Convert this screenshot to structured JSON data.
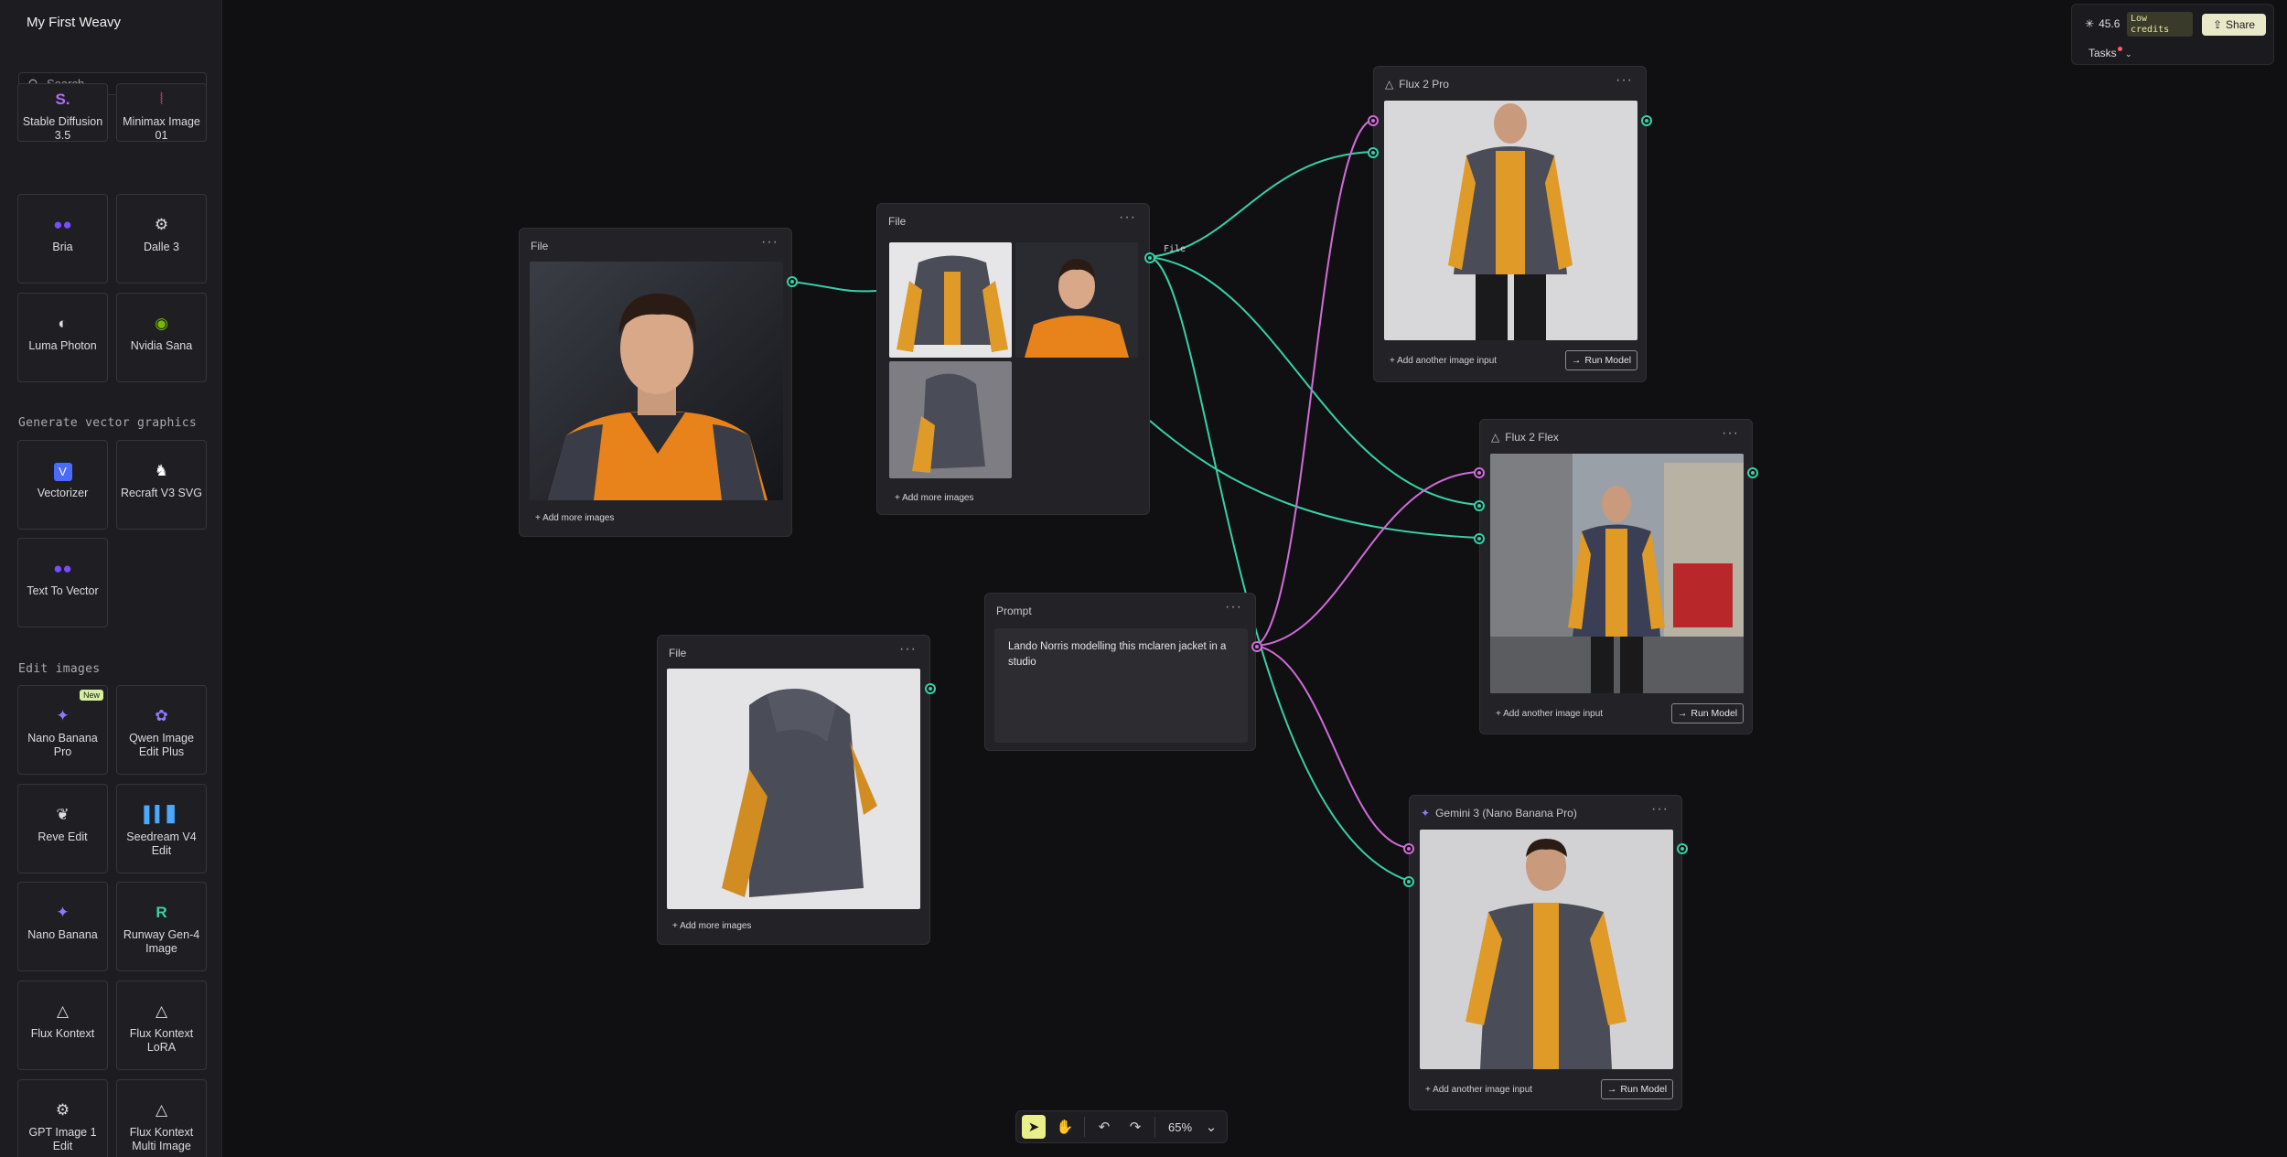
{
  "sidebar": {
    "title": "My First Weavy",
    "search_placeholder": "Search",
    "top_tiles": [
      {
        "label": "Stable Diffusion 3.5",
        "icon": "stable-diffusion-icon",
        "color": "#b36bff"
      },
      {
        "label": "Minimax Image 01",
        "icon": "minimax-icon",
        "color": "#e0506a"
      },
      {
        "label": "Bria",
        "icon": "bria-icon",
        "color": "#7a4cff"
      },
      {
        "label": "Dalle 3",
        "icon": "openai-icon",
        "color": "#dddddd"
      },
      {
        "label": "Luma Photon",
        "icon": "luma-icon",
        "color": "#dddddd"
      },
      {
        "label": "Nvidia Sana",
        "icon": "nvidia-icon",
        "color": "#76b900"
      }
    ],
    "vector_section": {
      "label": "Generate vector graphics",
      "tiles": [
        {
          "label": "Vectorizer",
          "icon": "vectorizer-icon",
          "color": "#4a6bff"
        },
        {
          "label": "Recraft V3 SVG",
          "icon": "recraft-icon",
          "color": "#ffffff"
        },
        {
          "label": "Text To Vector",
          "icon": "bria-icon",
          "color": "#7a4cff"
        }
      ]
    },
    "edit_section": {
      "label": "Edit images",
      "tiles": [
        {
          "label": "Nano Banana Pro",
          "icon": "gemini-sparkle-icon",
          "color": "#8a7bff",
          "badge": "New"
        },
        {
          "label": "Qwen Image Edit Plus",
          "icon": "qwen-icon",
          "color": "#8b7cff"
        },
        {
          "label": "Reve Edit",
          "icon": "reve-icon",
          "color": "#dddddd"
        },
        {
          "label": "Seedream V4 Edit",
          "icon": "seedream-icon",
          "color": "#4aa8ff"
        },
        {
          "label": "Nano Banana",
          "icon": "gemini-sparkle-icon",
          "color": "#8a7bff"
        },
        {
          "label": "Runway Gen-4 Image",
          "icon": "runway-icon",
          "color": "#3ad29f"
        },
        {
          "label": "Flux Kontext",
          "icon": "flux-icon",
          "color": "#dddddd"
        },
        {
          "label": "Flux Kontext LoRA",
          "icon": "flux-icon",
          "color": "#dddddd"
        },
        {
          "label": "GPT Image 1 Edit",
          "icon": "openai-icon",
          "color": "#dddddd"
        },
        {
          "label": "Flux Kontext Multi Image",
          "icon": "flux-icon",
          "color": "#dddddd"
        }
      ]
    }
  },
  "topbar": {
    "credits": "45.6",
    "low_credits": "Low credits",
    "share_label": "Share",
    "tasks_label": "Tasks"
  },
  "nodes": {
    "file_portrait": {
      "title": "File",
      "add_more": "+ Add more images"
    },
    "file_gallery": {
      "title": "File",
      "add_more": "+ Add more images",
      "output_label": "File"
    },
    "file_jacket": {
      "title": "File",
      "add_more": "+ Add more images"
    },
    "prompt": {
      "title": "Prompt",
      "text": "Lando Norris modelling this mclaren jacket in a studio"
    },
    "flux2pro": {
      "title": "Flux 2 Pro",
      "add_input": "Add another image input",
      "run_label": "Run Model"
    },
    "flux2flex": {
      "title": "Flux 2 Flex",
      "add_input": "Add another image input",
      "run_label": "Run Model"
    },
    "gemini3": {
      "title": "Gemini 3 (Nano Banana Pro)",
      "add_input": "Add another image input",
      "run_label": "Run Model"
    }
  },
  "toolbar": {
    "zoom": "65%",
    "tools": [
      "select-icon",
      "hand-icon",
      "undo-icon",
      "redo-icon"
    ]
  },
  "colors": {
    "edge_green": "#37d0a6",
    "edge_pink": "#d06bd8",
    "accent_yellow": "#e9f08a"
  }
}
